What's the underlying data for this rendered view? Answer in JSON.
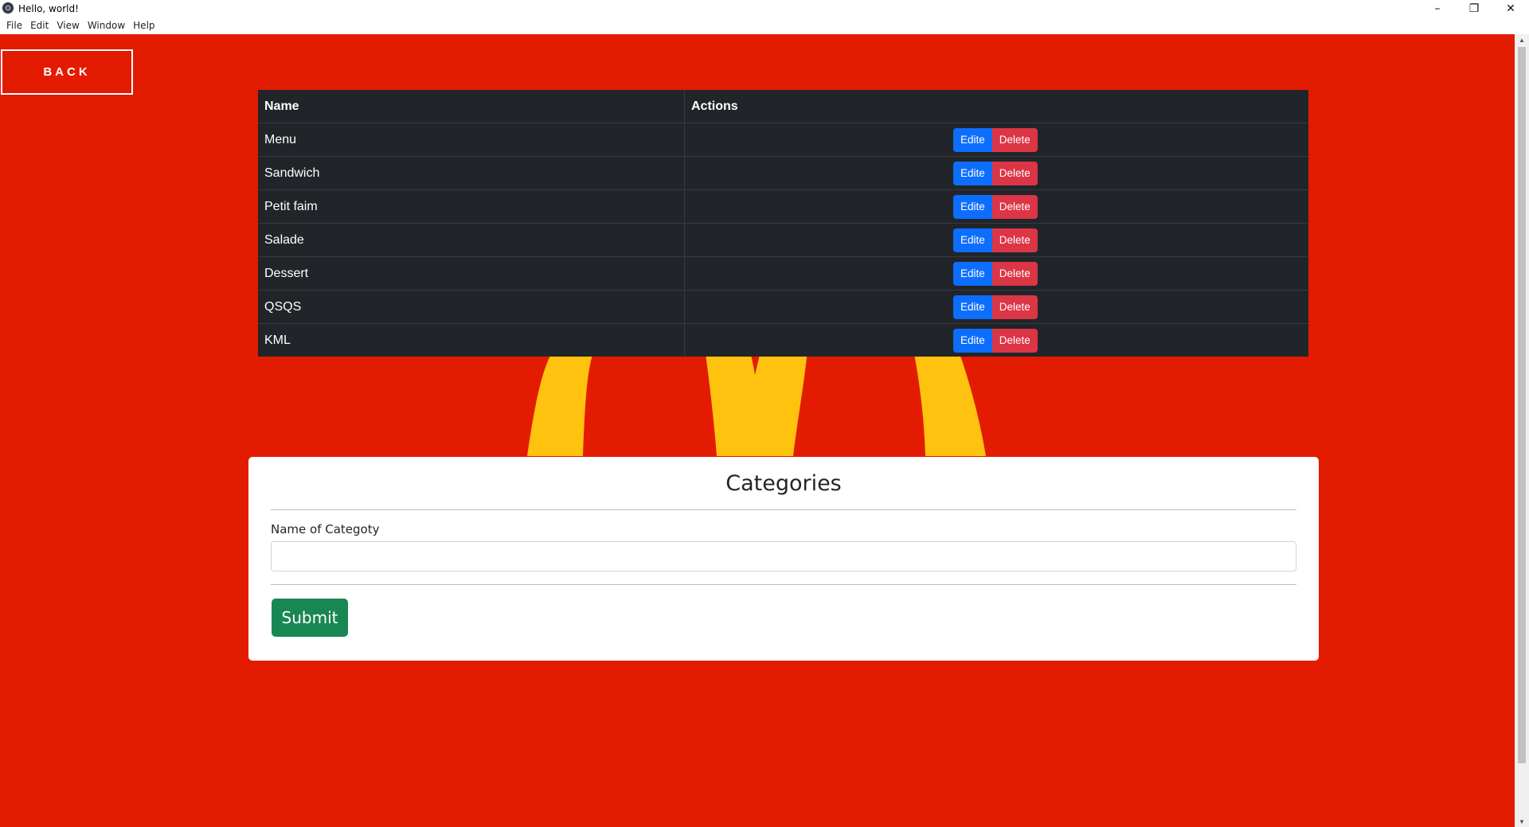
{
  "window": {
    "title": "Hello, world!",
    "controls": {
      "minimize": "–",
      "restore": "❐",
      "close": "✕"
    }
  },
  "menu": [
    "File",
    "Edit",
    "View",
    "Window",
    "Help"
  ],
  "back_label": "BACK",
  "table": {
    "headers": {
      "name": "Name",
      "actions": "Actions"
    },
    "rows": [
      {
        "name": "Menu",
        "edit": "Edite",
        "delete": "Delete"
      },
      {
        "name": "Sandwich",
        "edit": "Edite",
        "delete": "Delete"
      },
      {
        "name": "Petit faim",
        "edit": "Edite",
        "delete": "Delete"
      },
      {
        "name": "Salade",
        "edit": "Edite",
        "delete": "Delete"
      },
      {
        "name": "Dessert",
        "edit": "Edite",
        "delete": "Delete"
      },
      {
        "name": "QSQS",
        "edit": "Edite",
        "delete": "Delete"
      },
      {
        "name": "KML",
        "edit": "Edite",
        "delete": "Delete"
      }
    ]
  },
  "form": {
    "title": "Categories",
    "label": "Name of Categoty",
    "value": "",
    "placeholder": "",
    "submit_label": "Submit"
  },
  "colors": {
    "background": "#e31b00",
    "arch": "#ffc20e",
    "table_bg": "#212529",
    "edit_button": "#0d6efd",
    "delete_button": "#dc3545",
    "submit_button": "#198754"
  }
}
